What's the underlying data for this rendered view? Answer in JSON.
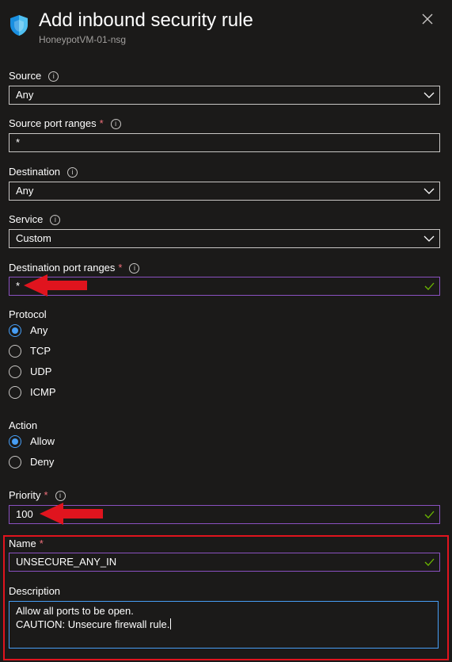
{
  "header": {
    "title": "Add inbound security rule",
    "subtitle": "HoneypotVM-01-nsg",
    "icon": "shield-icon",
    "close_icon": "close-icon"
  },
  "fields": {
    "source": {
      "label": "Source",
      "value": "Any"
    },
    "source_port_ranges": {
      "label": "Source port ranges",
      "required_mark": "*",
      "value": "*"
    },
    "destination": {
      "label": "Destination",
      "value": "Any"
    },
    "service": {
      "label": "Service",
      "value": "Custom"
    },
    "destination_port_ranges": {
      "label": "Destination port ranges",
      "required_mark": "*",
      "value": "*"
    },
    "priority": {
      "label": "Priority",
      "required_mark": "*",
      "value": "100"
    },
    "name": {
      "label": "Name",
      "required_mark": "*",
      "value": "UNSECURE_ANY_IN"
    },
    "description": {
      "label": "Description",
      "lines": [
        "Allow all ports to be open.",
        "CAUTION: Unsecure firewall rule."
      ]
    }
  },
  "protocol": {
    "label": "Protocol",
    "options": [
      "Any",
      "TCP",
      "UDP",
      "ICMP"
    ],
    "selected": "Any"
  },
  "action": {
    "label": "Action",
    "options": [
      "Allow",
      "Deny"
    ],
    "selected": "Allow"
  },
  "info_glyph": "i",
  "colors": {
    "background": "#1b1a19",
    "accent": "#479ef5",
    "valid_border": "#8a51c0",
    "valid_check": "#6bb700",
    "required": "#f1707b",
    "annotation_red": "#e0141e"
  }
}
